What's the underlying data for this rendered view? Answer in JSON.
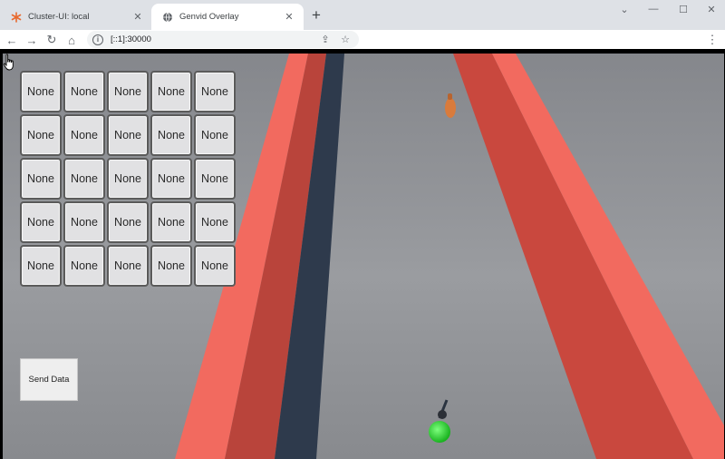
{
  "browser": {
    "tabs": [
      {
        "label": "Cluster-UI: local",
        "icon": "cluster-logo-icon",
        "active": false
      },
      {
        "label": "Genvid Overlay",
        "icon": "globe-icon",
        "active": true
      }
    ],
    "address": {
      "url": "[::1]:30000"
    }
  },
  "overlay": {
    "grid": [
      [
        "None",
        "None",
        "None",
        "None",
        "None"
      ],
      [
        "None",
        "None",
        "None",
        "None",
        "None"
      ],
      [
        "None",
        "None",
        "None",
        "None",
        "None"
      ],
      [
        "None",
        "None",
        "None",
        "None",
        "None"
      ],
      [
        "None",
        "None",
        "None",
        "None",
        "None"
      ]
    ],
    "send_label": "Send Data"
  },
  "colors": {
    "wall_red": "#d9534a",
    "wall_bright": "#f26a5f",
    "road_dark": "#2e3a4c",
    "floor": "#8a8d92",
    "player_green": "#3ad43a",
    "pickup_orange": "#d97b3c"
  }
}
